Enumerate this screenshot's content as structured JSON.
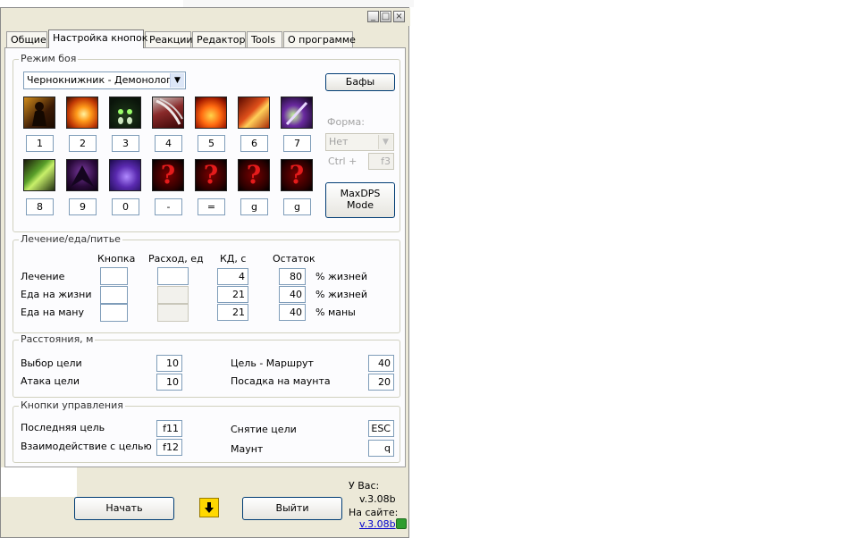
{
  "tabs": [
    "Общие",
    "Настройка кнопок",
    "Реакции",
    "Редактор",
    "Tools",
    "О программе"
  ],
  "active_tab": "Настройка кнопок",
  "combat": {
    "legend": "Режим боя",
    "spec": "Чернокнижник - Демонология",
    "buffs_button": "Бафы",
    "form_label": "Форма:",
    "form_value": "Нет",
    "ctrl_label": "Ctrl +",
    "ctrl_value": "f3",
    "maxdps_line1": "MaxDPS",
    "maxdps_line2": "Mode",
    "row1_keys": [
      "1",
      "2",
      "3",
      "4",
      "5",
      "6",
      "7"
    ],
    "row2_keys": [
      "8",
      "9",
      "0",
      "-",
      "=",
      "g",
      "g"
    ],
    "row1_icons": [
      "warlock-figure-icon",
      "fireball-icon",
      "demon-eyes-icon",
      "bloody-claw-icon",
      "flame-burst-icon",
      "fire-swirl-icon",
      "shadow-bolt-icon"
    ],
    "row2_icons": [
      "green-corruption-icon",
      "dark-wings-icon",
      "purple-hand-icon",
      "question-mark-icon",
      "question-mark-icon",
      "question-mark-icon",
      "question-mark-icon"
    ],
    "colors": {
      "question_bg": "#5a0000",
      "question_mark": "#e41b1b"
    }
  },
  "heal": {
    "legend": "Лечение/еда/питье",
    "headers": {
      "key": "Кнопка",
      "consume": "Расход, ед",
      "cd": "КД, с",
      "remaining": "Остаток"
    },
    "rows": [
      {
        "label": "Лечение",
        "key": "",
        "consume": "",
        "cd": "4",
        "remaining": "80",
        "unit": "% жизней"
      },
      {
        "label": "Еда на жизни",
        "key": "",
        "consume": "",
        "cd": "21",
        "remaining": "40",
        "unit": "% жизней"
      },
      {
        "label": "Еда на ману",
        "key": "",
        "consume": "",
        "cd": "21",
        "remaining": "40",
        "unit": "% маны"
      }
    ]
  },
  "dist": {
    "legend": "Расстояния, м",
    "target_select": {
      "label": "Выбор цели",
      "value": "10"
    },
    "attack": {
      "label": "Атака цели",
      "value": "10"
    },
    "route": {
      "label": "Цель - Маршрут",
      "value": "40"
    },
    "mount": {
      "label": "Посадка на маунта",
      "value": "20"
    }
  },
  "controls": {
    "legend": "Кнопки управления",
    "last_target": {
      "label": "Последняя цель",
      "value": "f11"
    },
    "interact": {
      "label": "Взаимодействие с целью",
      "value": "f12"
    },
    "clear_target": {
      "label": "Снятие цели",
      "value": "ESC"
    },
    "mount": {
      "label": "Маунт",
      "value": "q"
    }
  },
  "footer": {
    "start": "Начать",
    "exit": "Выйти",
    "you_have": "У Вас:",
    "local_version": "v.3.08b",
    "on_site": "На сайте:",
    "site_version": "v.3.08b"
  }
}
